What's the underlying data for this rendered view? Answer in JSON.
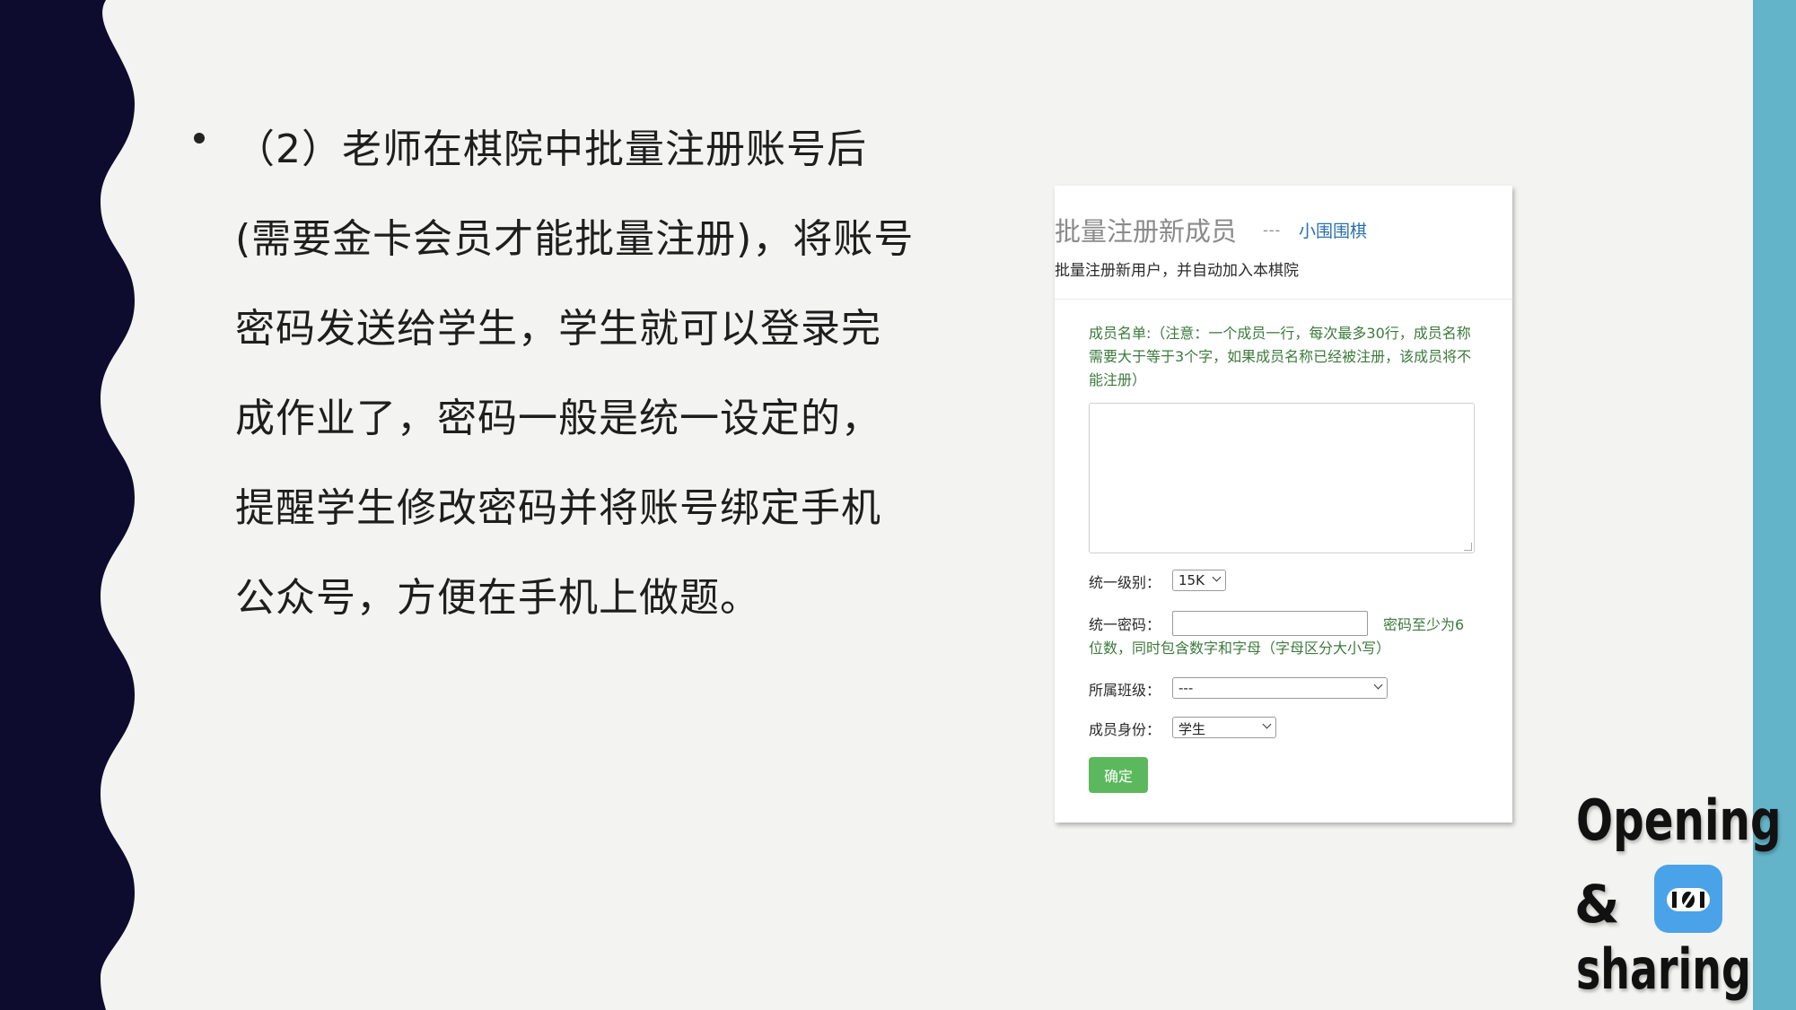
{
  "slide": {
    "bullet_lines": [
      "（2）老师在棋院中批量注册账号后",
      "(需要金卡会员才能批量注册)，将账号",
      "密码发送给学生，学生就可以登录完",
      "成作业了，密码一般是统一设定的，",
      "提醒学生修改密码并将账号绑定手机",
      "公众号，方便在手机上做题。"
    ]
  },
  "form": {
    "title": "批量注册新成员",
    "separator": "---",
    "link": "小围围棋",
    "subtitle": "批量注册新用户，并自动加入本棋院",
    "note": "成员名单:（注意：一个成员一行，每次最多30行，成员名称需要大于等于3个字，如果成员名称已经被注册，该成员将不能注册）",
    "level_label": "统一级别：",
    "level_value": "15K",
    "password_label": "统一密码：",
    "password_value": "",
    "password_hint_part1": "密码至少为6",
    "password_hint_part2": "位数，同时包含数字和字母（字母区分大小写）",
    "class_label": "所属班级：",
    "class_value": "---",
    "role_label": "成员身份：",
    "role_value": "学生",
    "submit_label": "确定"
  },
  "brand": {
    "word1": "Opening",
    "word2": "&",
    "word3": "sharing"
  },
  "colors": {
    "wave_dark": "#0d0b2e",
    "strip": "#63b4c9",
    "note_green": "#3c7a3c",
    "button_green": "#5cb85c",
    "link_blue": "#2a70a8",
    "logo_blue": "#4aa2e8"
  }
}
